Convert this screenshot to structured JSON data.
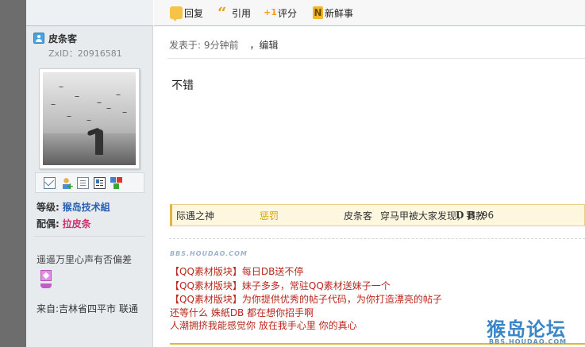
{
  "toolbar": {
    "reply_label": "回复",
    "quote_label": "引用",
    "rate_label": "评分",
    "news_label": "新鲜事",
    "icons": [
      "reply-icon",
      "quote-icon",
      "rate-icon",
      "news-icon"
    ]
  },
  "author": {
    "name": "皮条客",
    "zxid": "ZxID：20916581",
    "action_icons": [
      "message-icon",
      "add-friend-icon",
      "profile-icon",
      "card-icon",
      "blocks-icon"
    ],
    "level_label": "等级:",
    "level_value": "猴岛技术組",
    "spouse_label": "配偶:",
    "spouse_value": "拉皮条",
    "signature_text": "遥遥万里心声有否偏差",
    "location": "来自:吉林省四平市 联通"
  },
  "post": {
    "posted": "发表于: 9分钟前",
    "edit_label": "，编辑",
    "content": "不错"
  },
  "rating": {
    "user": "际遇之神",
    "type": "惩罚",
    "target": "皮条客",
    "reason": "穿马甲被大家发现，罚款",
    "currency": "D B",
    "amount": "-96"
  },
  "signature": {
    "watermark": "BBS.HOUDAO.COM",
    "lines": [
      "【QQ素材版块】每日DB送不停",
      "【QQ素材版块】妹子多多，常驻QQ素材送妹子一个",
      "【QQ素材版块】为你提供优秀的帖子代码，为你打造漂亮的帖子",
      " 还等什么  姝紙DB 都在想你招手啊",
      "人潮拥挤我能感觉你 放在我手心里 你的真心"
    ]
  },
  "logo": {
    "main": "猴岛论坛",
    "sub": "BBS.HOUDAO.COM"
  },
  "colors": {
    "link_blue": "#2b61b3",
    "link_pink": "#d0306d",
    "signature_red": "#b8281e",
    "rating_bg": "#fef7e0",
    "sidebar_bg": "#e7ebee"
  }
}
